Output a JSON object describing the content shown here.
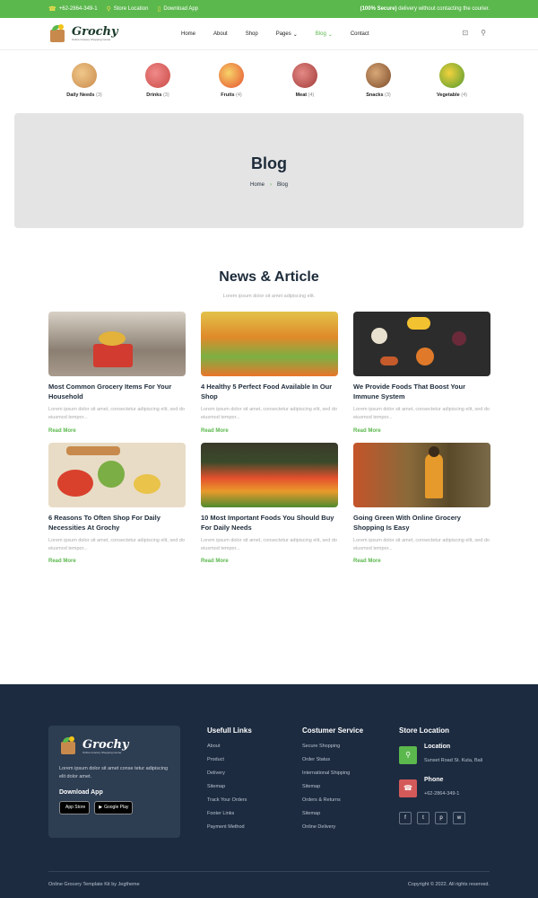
{
  "topbar": {
    "phone": "+62-2864-349-1",
    "location": "Store Location",
    "download": "Download App",
    "secure_bold": "(100% Secure)",
    "secure_text": " delivery without contacting the courier."
  },
  "brand": {
    "name": "Grochy",
    "tagline": "Online Grocery Shopping Center"
  },
  "nav": [
    "Home",
    "About",
    "Shop",
    "Pages",
    "Blog",
    "Contact"
  ],
  "categories": [
    {
      "label": "Daily Needs",
      "count": "(3)",
      "icon": "bag-icon",
      "color": "#d9a15f"
    },
    {
      "label": "Drinks",
      "count": "(3)",
      "icon": "bottles-icon",
      "color": "#c94a45"
    },
    {
      "label": "Fruits",
      "count": "(4)",
      "icon": "fruits-icon",
      "color": "#e5a52a"
    },
    {
      "label": "Meat",
      "count": "(4)",
      "icon": "meat-icon",
      "color": "#b2443f"
    },
    {
      "label": "Snacks",
      "count": "(3)",
      "icon": "snacks-icon",
      "color": "#a36b3c"
    },
    {
      "label": "Vegetable",
      "count": "(4)",
      "icon": "vegetable-icon",
      "color": "#6fae3c"
    }
  ],
  "banner": {
    "title": "Blog",
    "crumb_home": "Home",
    "crumb_current": "Blog"
  },
  "section": {
    "title": "News & Article",
    "subtitle": "Lorem ipsum dolor sit amet adipiscing elit."
  },
  "posts": [
    {
      "title": "Most Common Grocery Items For Your Household",
      "desc": "Lorem ipsum dolor sit amet, consectetur adipiscing elit, sed do eiusmod tempor...",
      "link": "Read More",
      "bg": "#8a7f72",
      "accent": "#d23b2f"
    },
    {
      "title": "4 Healthy 5 Perfect Food Available In Our Shop",
      "desc": "Lorem ipsum dolor sit amet, consectetur adipiscing elit, sed do eiusmod tempor...",
      "link": "Read More",
      "bg": "#c9a840",
      "accent": "#e9752b"
    },
    {
      "title": "We Provide Foods That Boost Your Immune System",
      "desc": "Lorem ipsum dolor sit amet, consectetur adipiscing elit, sed do eiusmod tempor...",
      "link": "Read More",
      "bg": "#2c2c2c",
      "accent": "#f2c230"
    },
    {
      "title": "6 Reasons To Often Shop For Daily Necessities At Grochy",
      "desc": "Lorem ipsum dolor sit amet, consectetur adipiscing elit, sed do eiusmod tempor...",
      "link": "Read More",
      "bg": "#d9c7a8",
      "accent": "#7bae44"
    },
    {
      "title": "10 Most Important Foods You Should Buy For Daily Needs",
      "desc": "Lorem ipsum dolor sit amet, consectetur adipiscing elit, sed do eiusmod tempor...",
      "link": "Read More",
      "bg": "#3a4a2a",
      "accent": "#e5502d"
    },
    {
      "title": "Going Green With Online Grocery Shopping Is Easy",
      "desc": "Lorem ipsum dolor sit amet, consectetur adipiscing elit, sed do eiusmod tempor...",
      "link": "Read More",
      "bg": "#6b5a3a",
      "accent": "#e59a2b"
    }
  ],
  "footer": {
    "desc": "Lorem ipsum dolor sit amet conse tetur adipiscing elit dolor amet.",
    "download_title": "Download App",
    "app_store": "App Store",
    "google_play": "Google Play",
    "useful_title": "Usefull Links",
    "useful": [
      "About",
      "Product",
      "Delivery",
      "Sitemap",
      "Track Your Orders",
      "Footer Links",
      "Payment Method"
    ],
    "service_title": "Costumer Service",
    "service": [
      "Secure Shopping",
      "Order Status",
      "International Shipping",
      "Sitemap",
      "Orders & Returns",
      "Sitemap",
      "Online Delivery"
    ],
    "store_title": "Store Location",
    "location_label": "Location",
    "location_value": "Sunset Road St. Kuta, Bali",
    "phone_label": "Phone",
    "phone_value": "+62-2864-349-1",
    "copy_left": "Online Grocery Template Kit by Jegtheme",
    "copy_right": "Copyright © 2022. All rights reserved."
  }
}
